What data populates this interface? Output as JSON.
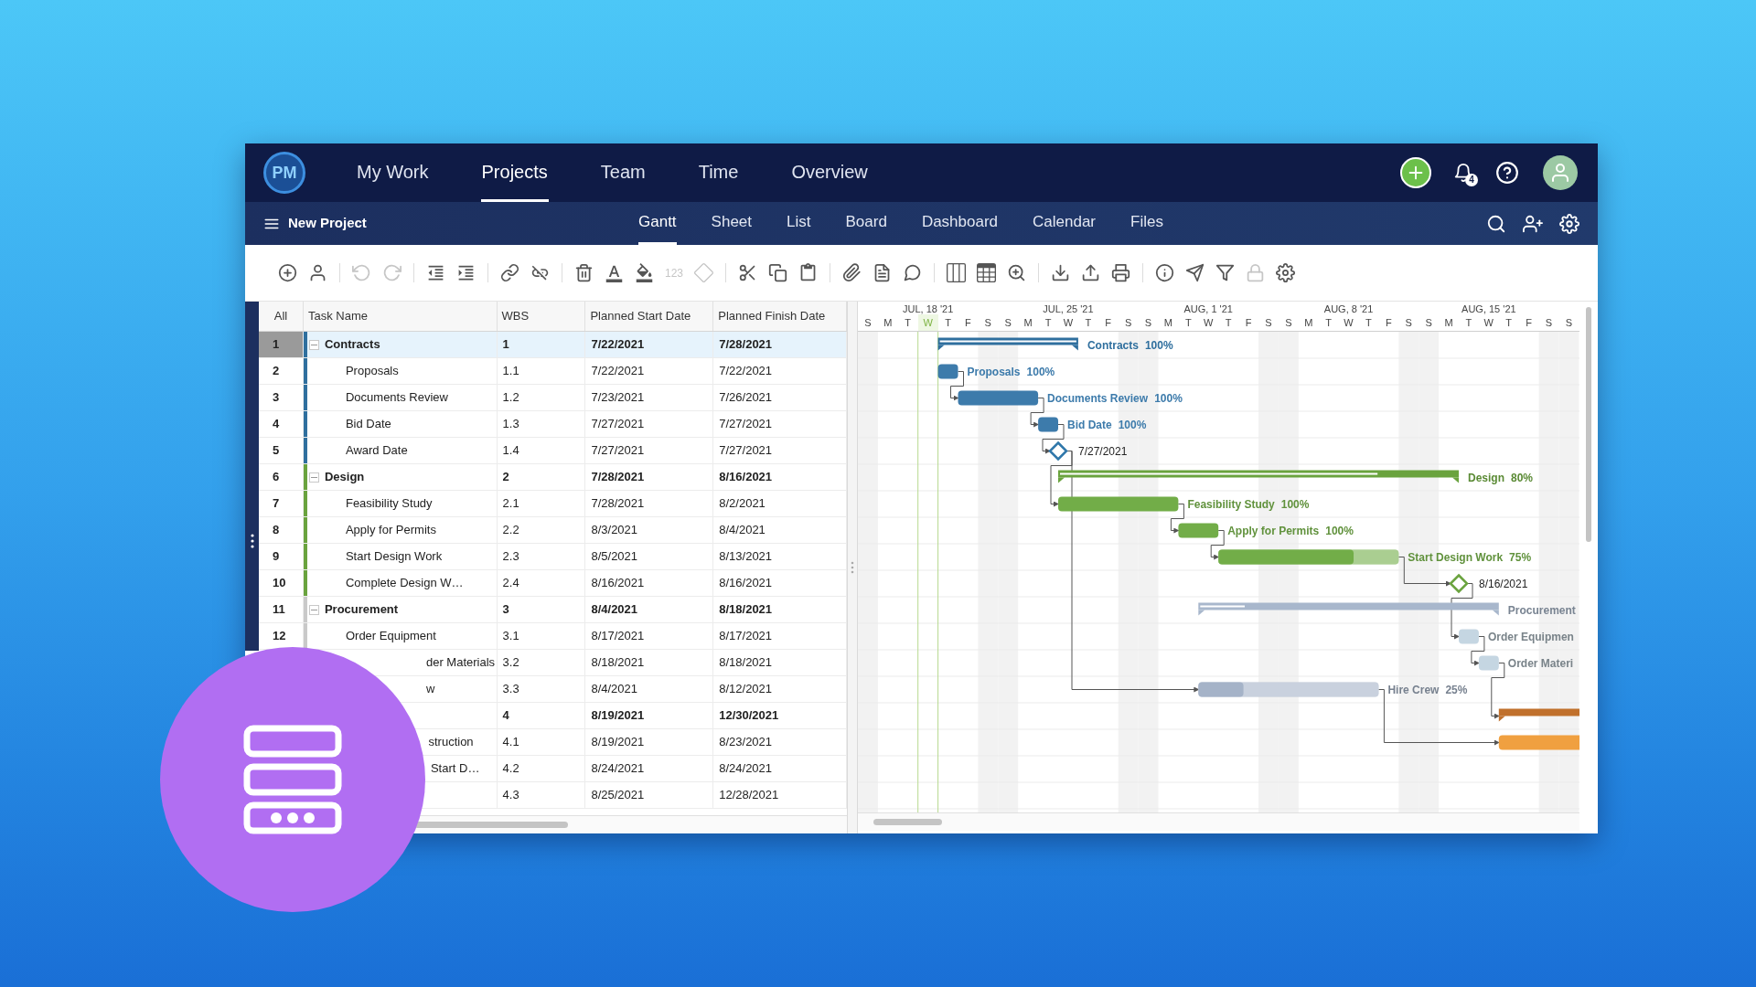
{
  "topnav": {
    "logo": "PM",
    "tabs": [
      {
        "label": "My Work",
        "selected": false
      },
      {
        "label": "Projects",
        "selected": true
      },
      {
        "label": "Team",
        "selected": false
      },
      {
        "label": "Time",
        "selected": false
      },
      {
        "label": "Overview",
        "selected": false
      }
    ],
    "notification_count": "4"
  },
  "subnav": {
    "project": "New Project",
    "tabs": [
      {
        "label": "Gantt",
        "selected": true
      },
      {
        "label": "Sheet",
        "selected": false
      },
      {
        "label": "List",
        "selected": false
      },
      {
        "label": "Board",
        "selected": false
      },
      {
        "label": "Dashboard",
        "selected": false
      },
      {
        "label": "Calendar",
        "selected": false
      },
      {
        "label": "Files",
        "selected": false
      }
    ]
  },
  "toolbar": {
    "groups": [
      [
        {
          "kind": "icon",
          "disabled": false
        },
        {
          "kind": "icon",
          "disabled": false
        }
      ],
      [
        {
          "kind": "icon",
          "disabled": true
        },
        {
          "kind": "icon",
          "disabled": true
        }
      ],
      [
        {
          "kind": "icon",
          "disabled": false
        },
        {
          "kind": "icon",
          "disabled": false
        }
      ],
      [
        {
          "kind": "icon",
          "disabled": false
        },
        {
          "kind": "icon",
          "disabled": false
        }
      ],
      [
        {
          "kind": "icon",
          "disabled": false
        },
        {
          "kind": "icon",
          "disabled": false
        },
        {
          "kind": "icon",
          "disabled": false
        },
        {
          "kind": "text",
          "text": "123",
          "disabled": true
        },
        {
          "kind": "icon",
          "disabled": true
        }
      ],
      [
        {
          "kind": "icon",
          "disabled": false
        },
        {
          "kind": "icon",
          "disabled": false
        },
        {
          "kind": "icon",
          "disabled": false
        }
      ],
      [
        {
          "kind": "icon",
          "disabled": false
        },
        {
          "kind": "icon",
          "disabled": false
        },
        {
          "kind": "icon",
          "disabled": false
        }
      ],
      [
        {
          "kind": "icon",
          "disabled": false
        },
        {
          "kind": "icon",
          "disabled": false
        },
        {
          "kind": "icon",
          "disabled": false
        }
      ],
      [
        {
          "kind": "icon",
          "disabled": false
        },
        {
          "kind": "icon",
          "disabled": false
        },
        {
          "kind": "icon",
          "disabled": false
        }
      ],
      [
        {
          "kind": "icon",
          "disabled": false
        },
        {
          "kind": "icon",
          "disabled": false
        },
        {
          "kind": "icon",
          "disabled": false
        },
        {
          "kind": "icon",
          "disabled": true
        },
        {
          "kind": "icon",
          "disabled": false
        }
      ]
    ]
  },
  "table": {
    "columns": [
      "All",
      "Task Name",
      "WBS",
      "Planned Start Date",
      "Planned Finish Date"
    ],
    "rows": [
      {
        "num": "1",
        "name": "Contracts",
        "wbs": "1",
        "start": "7/22/2021",
        "finish": "7/28/2021",
        "kind": "summary",
        "expanded": true,
        "selected": true,
        "color": "#2f6f9e",
        "bar": {
          "kind": "summary",
          "label": "Contracts",
          "percent": "100%",
          "level": 1,
          "color": "#2f6f9e"
        }
      },
      {
        "num": "2",
        "name": "Proposals",
        "wbs": "1.1",
        "start": "7/22/2021",
        "finish": "7/22/2021",
        "kind": "task",
        "selected": false,
        "color": "#2f6f9e",
        "bar": {
          "kind": "task",
          "label": "Proposals",
          "percent": "100%",
          "level": 1,
          "color": "#3d7bab"
        }
      },
      {
        "num": "3",
        "name": "Documents Review",
        "wbs": "1.2",
        "start": "7/23/2021",
        "finish": "7/26/2021",
        "kind": "task",
        "selected": false,
        "color": "#2f6f9e",
        "bar": {
          "kind": "task",
          "label": "Documents Review",
          "percent": "100%",
          "level": 1,
          "color": "#3d7bab",
          "link_1_up": true
        }
      },
      {
        "num": "4",
        "name": "Bid Date",
        "wbs": "1.3",
        "start": "7/27/2021",
        "finish": "7/27/2021",
        "kind": "task",
        "selected": false,
        "color": "#2f6f9e",
        "bar": {
          "kind": "task",
          "label": "Bid Date",
          "percent": "100%",
          "level": 1,
          "color": "#3d7bab",
          "link_1_up": true
        }
      },
      {
        "num": "5",
        "name": "Award Date",
        "wbs": "1.4",
        "start": "7/27/2021",
        "finish": "7/27/2021",
        "kind": "task",
        "selected": false,
        "color": "#2f6f9e",
        "bar": {
          "kind": "milestone",
          "label": "7/27/2021",
          "color": "#2f77aa",
          "link_1_up": true
        }
      },
      {
        "num": "6",
        "name": "Design",
        "wbs": "2",
        "start": "7/28/2021",
        "finish": "8/16/2021",
        "kind": "summary",
        "expanded": true,
        "selected": false,
        "color": "#6aa33e",
        "bar": {
          "kind": "summary",
          "label": "Design",
          "percent": "80%",
          "level": 0.8,
          "color": "#6aa33e"
        }
      },
      {
        "num": "7",
        "name": "Feasibility Study",
        "wbs": "2.1",
        "start": "7/28/2021",
        "finish": "8/2/2021",
        "kind": "task",
        "selected": false,
        "color": "#6aa33e",
        "bar": {
          "kind": "task",
          "label": "Feasibility Study",
          "percent": "100%",
          "level": 1,
          "color": "#72ad48",
          "link_2_up": true
        }
      },
      {
        "num": "8",
        "name": "Apply for Permits",
        "wbs": "2.2",
        "start": "8/3/2021",
        "finish": "8/4/2021",
        "kind": "task",
        "selected": false,
        "color": "#6aa33e",
        "bar": {
          "kind": "task",
          "label": "Apply for Permits",
          "percent": "100%",
          "level": 1,
          "color": "#72ad48",
          "link_1_up": true
        }
      },
      {
        "num": "9",
        "name": "Start Design Work",
        "wbs": "2.3",
        "start": "8/5/2021",
        "finish": "8/13/2021",
        "kind": "task",
        "selected": false,
        "color": "#6aa33e",
        "bar": {
          "kind": "task",
          "label": "Start Design Work",
          "percent": "75%",
          "level": 0.75,
          "color": "#72ad48",
          "link_1_up": true
        }
      },
      {
        "num": "10",
        "name": "Complete Design W…",
        "wbs": "2.4",
        "start": "8/16/2021",
        "finish": "8/16/2021",
        "kind": "task",
        "selected": false,
        "color": "#6aa33e",
        "bar": {
          "kind": "milestone",
          "label": "8/16/2021",
          "color": "#6aa33e",
          "link_1_up": true
        }
      },
      {
        "num": "11",
        "name": "Procurement",
        "wbs": "3",
        "start": "8/4/2021",
        "finish": "8/18/2021",
        "kind": "summary",
        "expanded": true,
        "selected": false,
        "color": "#c9c9c9",
        "bar": {
          "kind": "summary",
          "label": "Procurement",
          "level": 0.15,
          "color": "#a8b7cc"
        }
      },
      {
        "num": "12",
        "name": "Order Equipment",
        "wbs": "3.1",
        "start": "8/17/2021",
        "finish": "8/17/2021",
        "kind": "task",
        "selected": false,
        "color": "#c9c9c9",
        "bar": {
          "kind": "task",
          "label": "Order Equipmen",
          "color": "#c5d6e2",
          "link_2_up": true
        }
      },
      {
        "name": "der Materials",
        "wbs": "3.2",
        "start": "8/18/2021",
        "finish": "8/18/2021",
        "kind": "task",
        "selected": false,
        "bar": {
          "kind": "task",
          "label": "Order Materi",
          "color": "#c5d6e2",
          "link_1_up": true
        }
      },
      {
        "name": "w",
        "wbs": "3.3",
        "start": "8/4/2021",
        "finish": "8/12/2021",
        "kind": "task",
        "selected": false,
        "bar": {
          "kind": "task",
          "label": "Hire Crew",
          "percent": "25%",
          "level": 0.25,
          "color": "#a5b3c8",
          "link_9_up": true
        }
      },
      {
        "wbs": "4",
        "start": "8/19/2021",
        "finish": "12/30/2021",
        "kind": "summary",
        "selected": false,
        "bar": {
          "kind": "summary",
          "color": "#c0702c",
          "link_2_up": true
        }
      },
      {
        "name": "struction",
        "wbs": "4.1",
        "start": "8/19/2021",
        "finish": "8/23/2021",
        "kind": "task",
        "selected": false,
        "bar": {
          "kind": "task",
          "color": "#f0a040",
          "link_2_up": true
        }
      },
      {
        "name": "Start D…",
        "wbs": "4.2",
        "start": "8/24/2021",
        "finish": "8/24/2021",
        "kind": "task",
        "selected": false
      },
      {
        "wbs": "4.3",
        "start": "8/25/2021",
        "finish": "12/28/2021",
        "kind": "task",
        "selected": false
      }
    ]
  },
  "gantt": {
    "weeks": [
      {
        "label": "JUL, 18 '21",
        "days": [
          {
            "letter": "S",
            "today": false
          },
          {
            "letter": "M",
            "today": false
          },
          {
            "letter": "T",
            "today": false
          },
          {
            "letter": "W",
            "today": true
          },
          {
            "letter": "T",
            "today": false
          },
          {
            "letter": "F",
            "today": false
          },
          {
            "letter": "S",
            "today": false
          }
        ]
      },
      {
        "label": "JUL, 25 '21",
        "days": [
          {
            "letter": "S",
            "today": false
          },
          {
            "letter": "M",
            "today": false
          },
          {
            "letter": "T",
            "today": false
          },
          {
            "letter": "W",
            "today": false
          },
          {
            "letter": "T",
            "today": false
          },
          {
            "letter": "F",
            "today": false
          },
          {
            "letter": "S",
            "today": false
          }
        ]
      },
      {
        "label": "AUG, 1 '21",
        "days": [
          {
            "letter": "S",
            "today": false
          },
          {
            "letter": "M",
            "today": false
          },
          {
            "letter": "T",
            "today": false
          },
          {
            "letter": "W",
            "today": false
          },
          {
            "letter": "T",
            "today": false
          },
          {
            "letter": "F",
            "today": false
          },
          {
            "letter": "S",
            "today": false
          }
        ]
      },
      {
        "label": "AUG, 8 '21",
        "days": [
          {
            "letter": "S",
            "today": false
          },
          {
            "letter": "M",
            "today": false
          },
          {
            "letter": "T",
            "today": false
          },
          {
            "letter": "W",
            "today": false
          },
          {
            "letter": "T",
            "today": false
          },
          {
            "letter": "F",
            "today": false
          },
          {
            "letter": "S",
            "today": false
          }
        ]
      },
      {
        "label": "AUG, 15 '21",
        "days": [
          {
            "letter": "S",
            "today": false
          },
          {
            "letter": "M",
            "today": false
          },
          {
            "letter": "T",
            "today": false
          },
          {
            "letter": "W",
            "today": false
          },
          {
            "letter": "T",
            "today": false
          },
          {
            "letter": "F",
            "today": false
          },
          {
            "letter": "S",
            "today": false
          }
        ]
      },
      {
        "days": [
          {
            "letter": "S",
            "today": false
          }
        ]
      }
    ]
  }
}
